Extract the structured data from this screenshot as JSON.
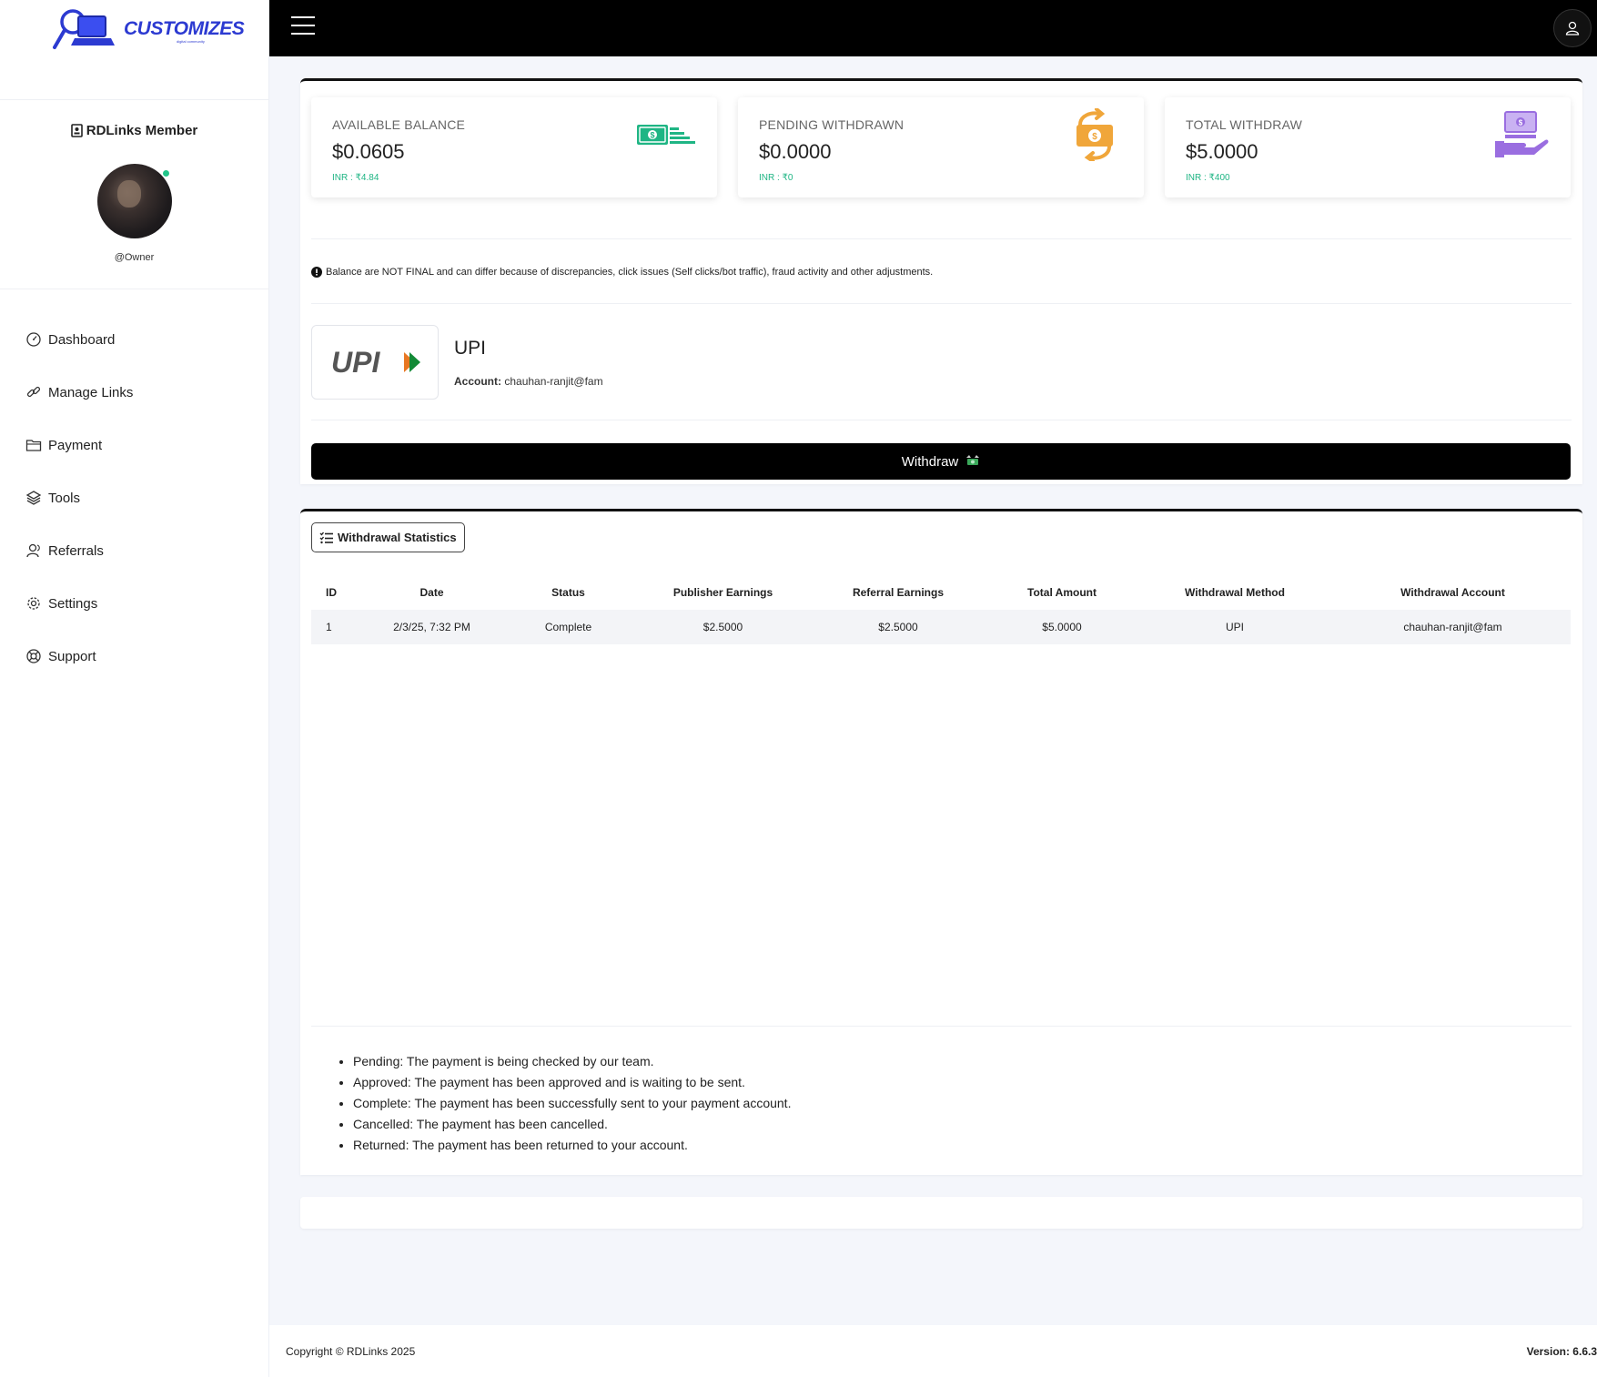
{
  "brand": {
    "name": "CUSTOMIZES",
    "tagline": "digital community"
  },
  "profile": {
    "title": "RDLinks Member",
    "handle": "@Owner"
  },
  "sidebar": {
    "items": [
      {
        "label": "Dashboard",
        "icon": "gauge-icon"
      },
      {
        "label": "Manage Links",
        "icon": "link-icon"
      },
      {
        "label": "Payment",
        "icon": "folder-icon"
      },
      {
        "label": "Tools",
        "icon": "layers-icon"
      },
      {
        "label": "Referrals",
        "icon": "user-group-icon"
      },
      {
        "label": "Settings",
        "icon": "gear-icon"
      },
      {
        "label": "Support",
        "icon": "lifebuoy-icon"
      }
    ]
  },
  "stats": [
    {
      "label": "AVAILABLE BALANCE",
      "value": "$0.0605",
      "inr": "INR : ₹4.84",
      "icon": "cash-stack-icon",
      "color": "#1fb584"
    },
    {
      "label": "PENDING WITHDRAWN",
      "value": "$0.0000",
      "inr": "INR : ₹0",
      "icon": "money-exchange-icon",
      "color": "#f0a63a"
    },
    {
      "label": "TOTAL WITHDRAW",
      "value": "$5.0000",
      "inr": "INR : ₹400",
      "icon": "hand-money-icon",
      "color": "#9a6ee0"
    }
  ],
  "notice": "Balance are NOT FINAL and can differ because of discrepancies, click issues (Self clicks/bot traffic), fraud activity and other adjustments.",
  "payment_method": {
    "name": "UPI",
    "logo_text": "UPI",
    "account_label": "Account:",
    "account": "chauhan-ranjit@fam"
  },
  "withdraw_button": "Withdraw",
  "stats_tab": "Withdrawal Statistics",
  "table": {
    "headers": [
      "ID",
      "Date",
      "Status",
      "Publisher Earnings",
      "Referral Earnings",
      "Total Amount",
      "Withdrawal Method",
      "Withdrawal Account"
    ],
    "rows": [
      [
        "1",
        "2/3/25, 7:32 PM",
        "Complete",
        "$2.5000",
        "$2.5000",
        "$5.0000",
        "UPI",
        "chauhan-ranjit@fam"
      ]
    ]
  },
  "legend": [
    {
      "term": "Pending:",
      "desc": "The payment is being checked by our team."
    },
    {
      "term": "Approved:",
      "desc": "The payment has been approved and is waiting to be sent."
    },
    {
      "term": "Complete:",
      "desc": "The payment has been successfully sent to your payment account."
    },
    {
      "term": "Cancelled:",
      "desc": "The payment has been cancelled."
    },
    {
      "term": "Returned:",
      "desc": "The payment has been returned to your account."
    }
  ],
  "footer": {
    "copyright": "Copyright © RDLinks 2025",
    "version": "Version: 6.6.3"
  }
}
